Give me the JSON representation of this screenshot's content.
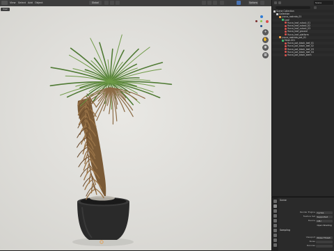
{
  "app": {
    "colors": {
      "viewport_bg": "#dfdeda",
      "panel_bg": "#282828",
      "accent": "#4772b3",
      "object_orange": "#e59a47",
      "material_red": "#d9534f"
    }
  },
  "viewport": {
    "header": {
      "mode_icon": "cube-mode-icon",
      "menu": [
        "View",
        "Select",
        "Add",
        "Object"
      ],
      "global_label": "Global",
      "options_label": "Options"
    },
    "camera_label": "User",
    "gizmo": {
      "x": "X",
      "y": "Y",
      "z": "Z"
    },
    "nav_buttons": [
      "zoom-icon",
      "hand-icon",
      "camera-icon",
      "grid-icon"
    ]
  },
  "outliner": {
    "scene_label": "Scene",
    "rows": [
      {
        "label": "Scene Collection",
        "indent": 0,
        "icon": "coll"
      },
      {
        "label": "Collection",
        "indent": 1,
        "icon": "coll"
      },
      {
        "label": "yucca_rostrata_01",
        "indent": 2,
        "icon": "obj"
      },
      {
        "label": "Leaf",
        "indent": 3,
        "icon": "mesh"
      },
      {
        "label": "Yucca_leaf_cutout_01",
        "indent": 4,
        "icon": "mat"
      },
      {
        "label": "Yucca_leaf_cutout_02",
        "indent": 4,
        "icon": "mat"
      },
      {
        "label": "Yucca_leaf_cutout_03",
        "indent": 4,
        "icon": "mat"
      },
      {
        "label": "Yucca_leaf_ground",
        "indent": 4,
        "icon": "mat"
      },
      {
        "label": "Yucca_leaf_platform",
        "indent": 4,
        "icon": "mat"
      },
      {
        "label": "yucca_rostrata_pot_01",
        "indent": 2,
        "icon": "obj"
      },
      {
        "label": "Mesh.001",
        "indent": 3,
        "icon": "mesh"
      },
      {
        "label": "Yucca_pot_black_leaf_01",
        "indent": 4,
        "icon": "mat"
      },
      {
        "label": "Yucca_pot_black_leaf_02",
        "indent": 4,
        "icon": "mat"
      },
      {
        "label": "Yucca_pot_black_leaf_03",
        "indent": 4,
        "icon": "mat"
      },
      {
        "label": "Yucca_pot_black_leaf_04",
        "indent": 4,
        "icon": "mat"
      },
      {
        "label": "Yucca_pot_black_stem",
        "indent": 4,
        "icon": "mat"
      }
    ]
  },
  "properties": {
    "title": "Scene",
    "rows": [
      {
        "label": "Render Engine",
        "value": "Cycles"
      },
      {
        "label": "Feature Set",
        "value": "Supported"
      },
      {
        "label": "Device",
        "value": "CPU"
      },
      {
        "label": "",
        "value": "Open Shading"
      }
    ],
    "sampling": {
      "header": "Sampling",
      "rows": [
        {
          "label": "Viewport",
          "value": "Noise Thresh"
        },
        {
          "label": "Noise",
          "value": ""
        },
        {
          "label": "Denoise",
          "value": ""
        }
      ]
    }
  }
}
